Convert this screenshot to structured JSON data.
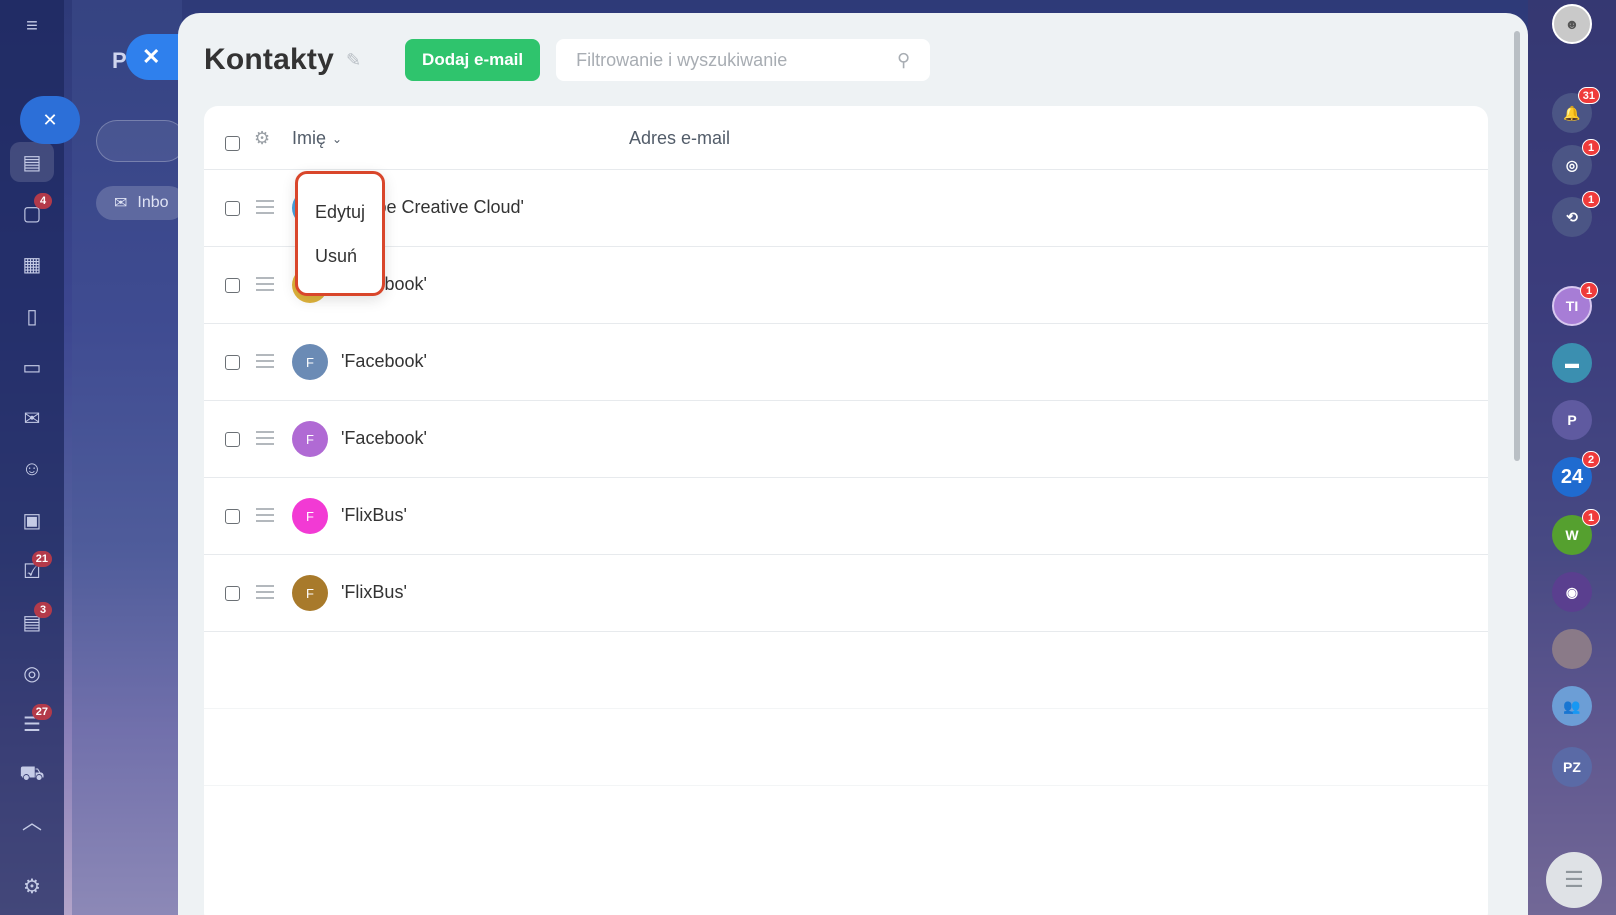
{
  "background_app": {
    "letter": "P",
    "inbox_label": "Inbo"
  },
  "leftnav": {
    "items": [
      {
        "name": "menu-icon",
        "glyph": "≡",
        "badge": ""
      },
      {
        "name": "feed-icon",
        "glyph": "▤",
        "badge": ""
      },
      {
        "name": "chat-icon",
        "glyph": "▢",
        "badge": "4"
      },
      {
        "name": "calendar-icon",
        "glyph": "▦",
        "badge": ""
      },
      {
        "name": "document-icon",
        "glyph": "▯",
        "badge": ""
      },
      {
        "name": "drive-icon",
        "glyph": "▭",
        "badge": ""
      },
      {
        "name": "mail-icon",
        "glyph": "✉",
        "badge": ""
      },
      {
        "name": "contacts-icon",
        "glyph": "☺",
        "badge": ""
      },
      {
        "name": "presentation-icon",
        "glyph": "▣",
        "badge": ""
      },
      {
        "name": "tasks-icon",
        "glyph": "☑",
        "badge": "21"
      },
      {
        "name": "crm-icon",
        "glyph": "▤",
        "badge": "3"
      },
      {
        "name": "goals-icon",
        "glyph": "◎",
        "badge": ""
      },
      {
        "name": "filter-icon",
        "glyph": "☰",
        "badge": "27"
      },
      {
        "name": "cart-icon",
        "glyph": "⛟",
        "badge": ""
      },
      {
        "name": "collapse-icon",
        "glyph": "︿",
        "badge": ""
      },
      {
        "name": "settings-icon",
        "glyph": "⚙",
        "badge": ""
      }
    ]
  },
  "slider": {
    "close_label": "✕",
    "title": "Kontakty",
    "add_button": "Dodaj e-mail",
    "search": {
      "placeholder": "Filtrowanie i wyszukiwanie"
    }
  },
  "table": {
    "columns": {
      "name": "Imię",
      "email": "Adres e-mail"
    },
    "rows": [
      {
        "initial": "",
        "name": "'Adobe Creative Cloud'",
        "color": "#4aa3df"
      },
      {
        "initial": "",
        "name": "'Facebook'",
        "color": "#e0b43c"
      },
      {
        "initial": "F",
        "name": "'Facebook'",
        "color": "#6b8bb5"
      },
      {
        "initial": "F",
        "name": "'Facebook'",
        "color": "#b06ad4"
      },
      {
        "initial": "F",
        "name": "'FlixBus'",
        "color": "#f23ad4"
      },
      {
        "initial": "F",
        "name": "'FlixBus'",
        "color": "#a87a2b"
      }
    ]
  },
  "context_menu": {
    "edit": "Edytuj",
    "delete": "Usuń"
  },
  "rightbar": {
    "items": [
      {
        "name": "notifications-icon",
        "label": "🔔",
        "badge": "31",
        "color": "#4b5585"
      },
      {
        "name": "activity-icon",
        "label": "◎",
        "badge": "1",
        "color": "#4b5585"
      },
      {
        "name": "support-chat-icon",
        "label": "⟲",
        "badge": "1",
        "color": "#4b5585"
      },
      {
        "name": "avatar-ti",
        "label": "TI",
        "badge": "1",
        "color": "#a77dd6"
      },
      {
        "name": "open-channel-icon",
        "label": "▬",
        "badge": "",
        "color": "#3b8fb0"
      },
      {
        "name": "avatar-p",
        "label": "P",
        "badge": "",
        "color": "#5f5aa0"
      },
      {
        "name": "bitrix24-icon",
        "label": "24",
        "badge": "2",
        "color": "#1f6bd0"
      },
      {
        "name": "avatar-w",
        "label": "W",
        "badge": "1",
        "color": "#55a02f"
      },
      {
        "name": "copilot-icon",
        "label": "◉",
        "badge": "",
        "color": "#5a3f8f"
      },
      {
        "name": "group-photo-avatar",
        "label": "",
        "badge": "",
        "color": "#8a7a88"
      },
      {
        "name": "group-icon",
        "label": "👥",
        "badge": "",
        "color": "#6c9ed6"
      },
      {
        "name": "avatar-pz",
        "label": "PZ",
        "badge": "",
        "color": "#5a6aa6"
      }
    ]
  }
}
